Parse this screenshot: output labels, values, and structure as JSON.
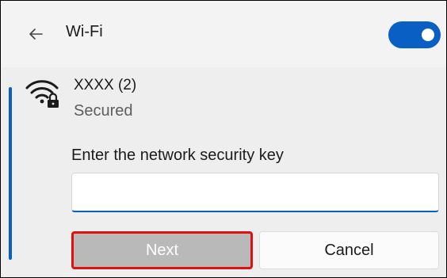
{
  "header": {
    "back_icon": "arrow-left-icon",
    "title": "Wi-Fi",
    "toggle_on": true,
    "accent_color": "#0a5fc4"
  },
  "network": {
    "icon": "wifi-secured-icon",
    "name": "XXXX (2)",
    "status": "Secured"
  },
  "form": {
    "key_label": "Enter the network security key",
    "key_value": "",
    "key_placeholder": ""
  },
  "buttons": {
    "next_label": "Next",
    "next_enabled": false,
    "cancel_label": "Cancel",
    "highlight_color": "#e01010"
  }
}
